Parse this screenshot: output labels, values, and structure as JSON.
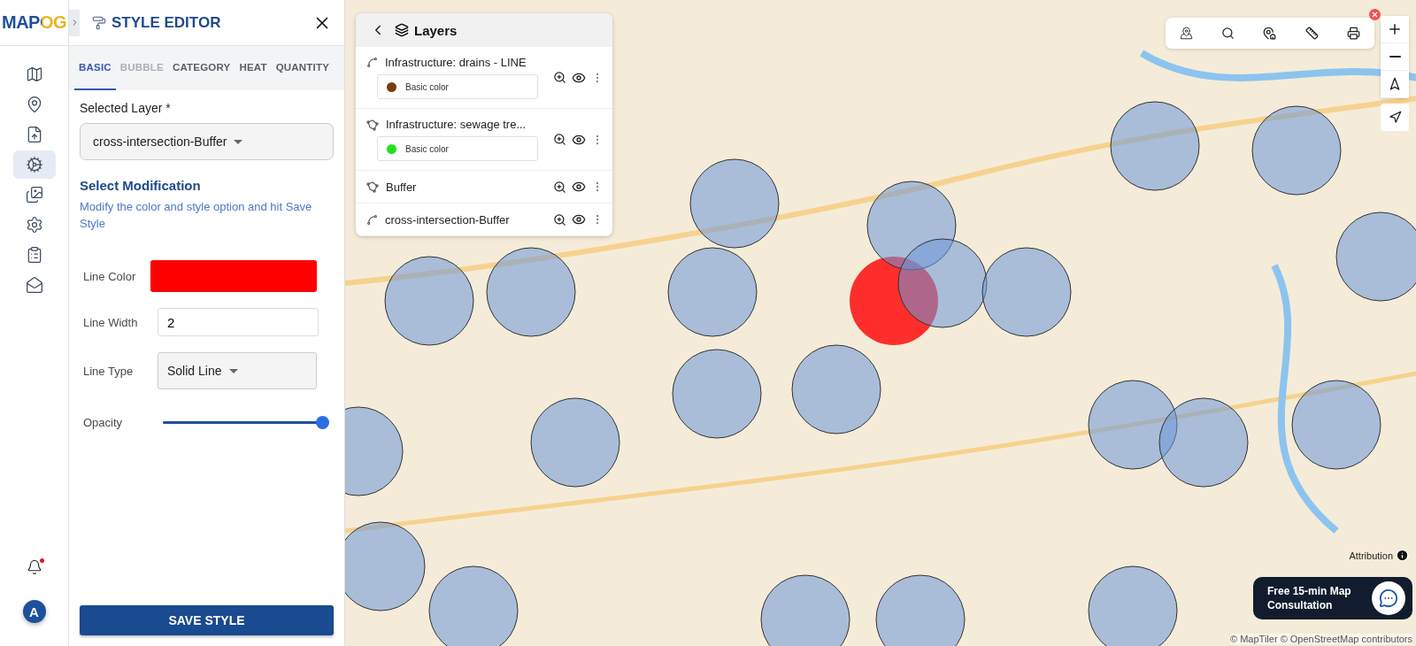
{
  "logo": {
    "text": "MAPOG"
  },
  "rail": {
    "items": [
      {
        "kind": "map",
        "selected": false
      },
      {
        "kind": "pin",
        "selected": false
      },
      {
        "kind": "upload",
        "selected": false
      },
      {
        "kind": "style",
        "selected": true
      },
      {
        "kind": "gallery",
        "selected": false
      },
      {
        "kind": "settings",
        "selected": false
      },
      {
        "kind": "form",
        "selected": false
      },
      {
        "kind": "share",
        "selected": false
      }
    ],
    "notifications": {
      "unread": true
    },
    "avatar": "A"
  },
  "editor": {
    "title": "STYLE EDITOR",
    "tabs": [
      {
        "label": "BASIC",
        "selected": true,
        "disabled": false
      },
      {
        "label": "BUBBLE",
        "selected": false,
        "disabled": true
      },
      {
        "label": "CATEGORY",
        "selected": false,
        "disabled": false
      },
      {
        "label": "HEAT",
        "selected": false,
        "disabled": false
      },
      {
        "label": "QUANTITY",
        "selected": false,
        "disabled": false
      }
    ],
    "selected_layer": {
      "label": "Selected Layer *",
      "value": "cross-intersection-Buffer"
    },
    "section_title": "Select Modification",
    "hint": "Modify the color and style option and hit Save Style",
    "line_color": {
      "label": "Line Color",
      "color": "#ff0000"
    },
    "line_width": {
      "label": "Line Width",
      "value": "2"
    },
    "line_type": {
      "label": "Line Type",
      "value": "Solid Line"
    },
    "opacity": {
      "label": "Opacity",
      "level": 1
    },
    "save": "SAVE STYLE"
  },
  "layers_panel": {
    "title": "Layers",
    "layers": [
      {
        "kind": "line",
        "name": "Infrastructure: drains - LINE",
        "legend": {
          "label": "Basic color",
          "color": "#7a3e0c"
        }
      },
      {
        "kind": "polygon",
        "name": "Infrastructure: sewage tre...",
        "legend": {
          "label": "Basic color",
          "color": "#22e01a"
        }
      },
      {
        "kind": "polygon",
        "name": "Buffer"
      },
      {
        "kind": "line",
        "name": "cross-intersection-Buffer"
      }
    ]
  },
  "consultation": "Free 15-min Map Consultation",
  "attribution": {
    "label": "Attribution",
    "credits": "© MapTiler © OpenStreetMap contributors"
  }
}
